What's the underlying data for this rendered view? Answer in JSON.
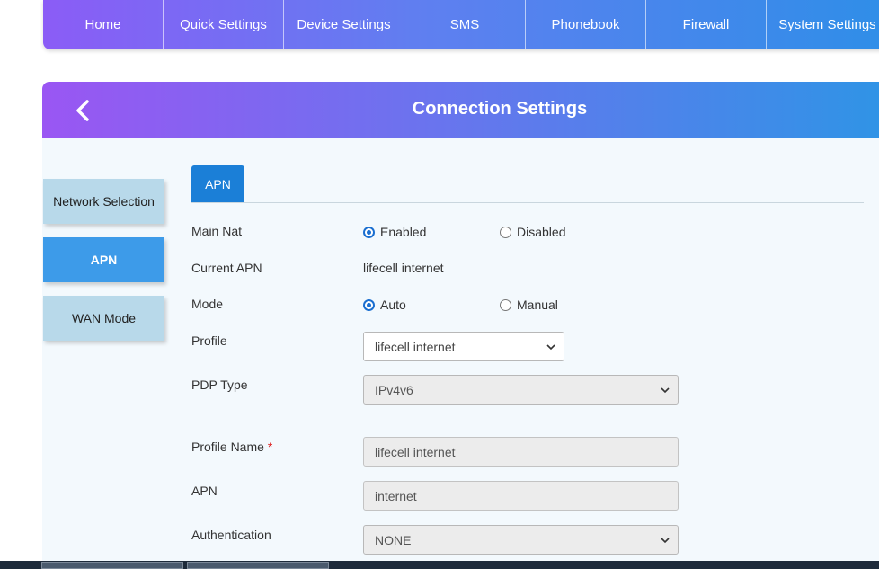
{
  "nav": {
    "items": [
      {
        "label": "Home",
        "width": 134
      },
      {
        "label": "Quick Settings",
        "width": 134
      },
      {
        "label": "Device Settings",
        "width": 134
      },
      {
        "label": "SMS",
        "width": 135
      },
      {
        "label": "Phonebook",
        "width": 134
      },
      {
        "label": "Firewall",
        "width": 134
      },
      {
        "label": "System Settings",
        "width": 135
      }
    ]
  },
  "panel": {
    "title": "Connection Settings",
    "back_icon": "chevron-left-icon"
  },
  "sidebar": {
    "items": [
      {
        "label": "Network Selection",
        "active": false
      },
      {
        "label": "APN",
        "active": true
      },
      {
        "label": "WAN Mode",
        "active": false
      }
    ]
  },
  "tabs": {
    "active": "APN"
  },
  "form": {
    "main_nat": {
      "label": "Main Nat",
      "opt_enabled": "Enabled",
      "opt_disabled": "Disabled",
      "selected": "Enabled"
    },
    "current_apn": {
      "label": "Current APN",
      "value": "lifecell internet"
    },
    "mode": {
      "label": "Mode",
      "opt_auto": "Auto",
      "opt_manual": "Manual",
      "selected": "Auto"
    },
    "profile": {
      "label": "Profile",
      "value": "lifecell internet"
    },
    "pdp_type": {
      "label": "PDP Type",
      "value": "IPv4v6"
    },
    "profile_name": {
      "label": "Profile Name",
      "required_mark": "*",
      "value": "lifecell internet"
    },
    "apn": {
      "label": "APN",
      "value": "internet"
    },
    "authentication": {
      "label": "Authentication",
      "value": "NONE"
    }
  },
  "colors": {
    "accent": "#1b7fd7",
    "sidebar_active": "#3d9be9",
    "sidebar_inactive": "#b8d9ea"
  }
}
